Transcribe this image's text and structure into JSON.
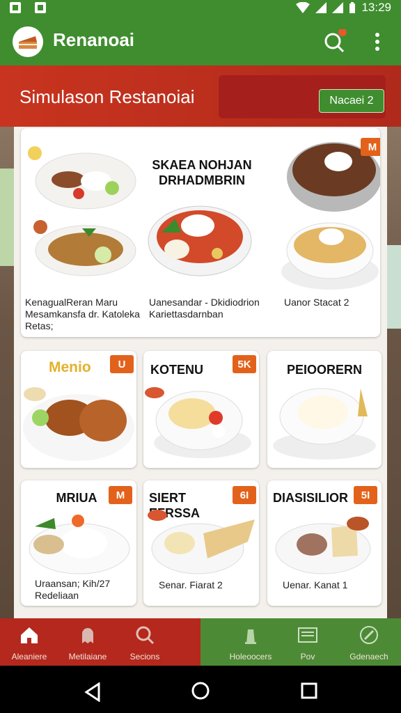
{
  "status_bar": {
    "time": "13:29"
  },
  "app_bar": {
    "title": "Renanoai"
  },
  "hero": {
    "title": "Simulason Restanoiai",
    "button": "Nacaei 2"
  },
  "cards": [
    {
      "heading": "SKAEA NOHJAN\nDRHADMBRIN",
      "badge": "M",
      "captions": [
        "KenagualReran Maru\nMesamkansfa dr. Katoleka\nRetas;",
        "Uanesandar - Dkidiodrion\nKariettasdarnban",
        "Uanor Stacat 2"
      ]
    },
    {
      "heading": "Menio",
      "badge": "U",
      "title2": "KOTENU",
      "badge2": "5K",
      "title3": "PEIOORERN"
    },
    {
      "heading": "MRIUA",
      "badge": "M",
      "title2": "SIERT EFRSSA",
      "badge2": "6I",
      "title3": "DIASISILIOR",
      "badge3": "5I",
      "captions": [
        "Uraansan; Kih/27\nRedeliaan",
        "Senar. Fiarat 2",
        "Uenar. Kanat 1"
      ]
    }
  ],
  "bottom_nav": [
    {
      "label": "Aleaniere",
      "icon": "home-icon"
    },
    {
      "label": "Metilaiane",
      "icon": "ghost-icon"
    },
    {
      "label": "Secions",
      "icon": "search-icon"
    },
    {
      "label": "Holeoocers",
      "icon": "chef-icon"
    },
    {
      "label": "Pov",
      "icon": "newspaper-icon"
    },
    {
      "label": "Gdenaech",
      "icon": "edit-icon"
    }
  ]
}
